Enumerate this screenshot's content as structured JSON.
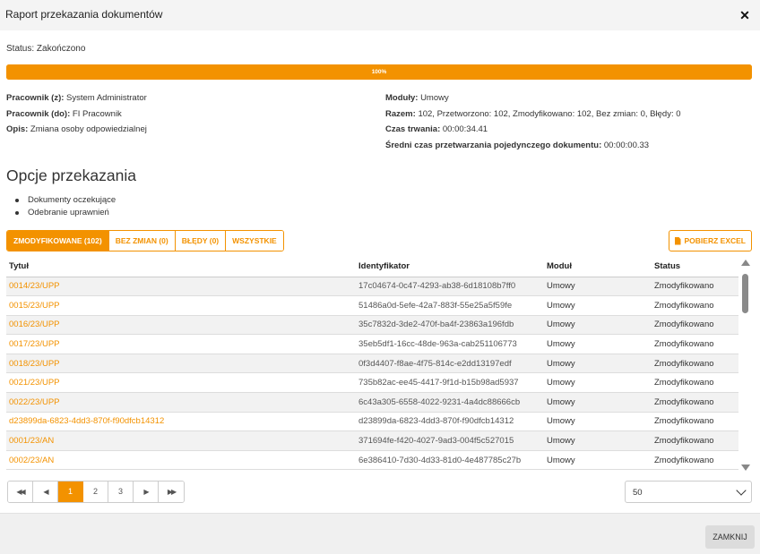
{
  "dialog": {
    "title": "Raport przekazania dokumentów"
  },
  "status": {
    "label": "Status:",
    "value": "Zakończono"
  },
  "progress": {
    "percent": 100,
    "label": "100%"
  },
  "info_left": [
    {
      "label": "Pracownik (z):",
      "value": "System Administrator"
    },
    {
      "label": "Pracownik (do):",
      "value": "FI Pracownik"
    },
    {
      "label": "Opis:",
      "value": "Zmiana osoby odpowiedzialnej"
    }
  ],
  "info_right": [
    {
      "label": "Moduły:",
      "value": "Umowy"
    },
    {
      "label": "Razem:",
      "value": "102, Przetworzono: 102, Zmodyfikowano: 102, Bez zmian: 0, Błędy: 0"
    },
    {
      "label": "Czas trwania:",
      "value": "00:00:34.41"
    },
    {
      "label": "Średni czas przetwarzania pojedynczego dokumentu:",
      "value": "00:00:00.33"
    }
  ],
  "options": {
    "title": "Opcje przekazania",
    "items": [
      "Dokumenty oczekujące",
      "Odebranie uprawnień"
    ]
  },
  "tabs": [
    {
      "label": "ZMODYFIKOWANE (102)",
      "active": true
    },
    {
      "label": "BEZ ZMIAN (0)",
      "active": false
    },
    {
      "label": "BŁĘDY (0)",
      "active": false
    },
    {
      "label": "WSZYSTKIE",
      "active": false
    }
  ],
  "excel_button": {
    "label": "POBIERZ EXCEL",
    "icon": "file-icon"
  },
  "table": {
    "columns": [
      "Tytuł",
      "Identyfikator",
      "Moduł",
      "Status"
    ],
    "rows": [
      [
        "0014/23/UPP",
        "17c04674-0c47-4293-ab38-6d18108b7ff0",
        "Umowy",
        "Zmodyfikowano"
      ],
      [
        "0015/23/UPP",
        "51486a0d-5efe-42a7-883f-55e25a5f59fe",
        "Umowy",
        "Zmodyfikowano"
      ],
      [
        "0016/23/UPP",
        "35c7832d-3de2-470f-ba4f-23863a196fdb",
        "Umowy",
        "Zmodyfikowano"
      ],
      [
        "0017/23/UPP",
        "35eb5df1-16cc-48de-963a-cab251106773",
        "Umowy",
        "Zmodyfikowano"
      ],
      [
        "0018/23/UPP",
        "0f3d4407-f8ae-4f75-814c-e2dd13197edf",
        "Umowy",
        "Zmodyfikowano"
      ],
      [
        "0021/23/UPP",
        "735b82ac-ee45-4417-9f1d-b15b98ad5937",
        "Umowy",
        "Zmodyfikowano"
      ],
      [
        "0022/23/UPP",
        "6c43a305-6558-4022-9231-4a4dc88666cb",
        "Umowy",
        "Zmodyfikowano"
      ],
      [
        "d23899da-6823-4dd3-870f-f90dfcb14312",
        "d23899da-6823-4dd3-870f-f90dfcb14312",
        "Umowy",
        "Zmodyfikowano"
      ],
      [
        "0001/23/AN",
        "371694fe-f420-4027-9ad3-004f5c527015",
        "Umowy",
        "Zmodyfikowano"
      ],
      [
        "0002/23/AN",
        "6e386410-7d30-4d33-81d0-4e487785c27b",
        "Umowy",
        "Zmodyfikowano"
      ]
    ]
  },
  "pagination": {
    "pages": [
      "1",
      "2",
      "3"
    ],
    "current": "1",
    "first_icon": "first-page-icon",
    "prev_icon": "prev-page-icon",
    "next_icon": "next-page-icon",
    "last_icon": "last-page-icon"
  },
  "page_size": {
    "value": "50"
  },
  "footer": {
    "close_label": "ZAMKNIJ"
  },
  "colors": {
    "accent": "#f39200",
    "row_alt": "#f2f2f2"
  }
}
